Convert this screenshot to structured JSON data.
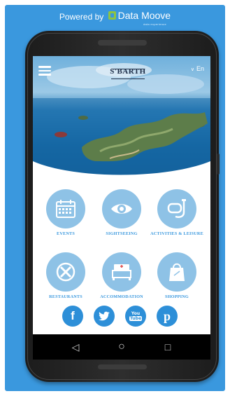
{
  "banner": {
    "powered_by": "Powered by",
    "brand_name": "Data Moove",
    "brand_tagline": "data experience"
  },
  "header": {
    "logo_text": "S'BARTH",
    "language_label": "En",
    "language_chevron": "∨"
  },
  "tiles": [
    {
      "label": "EVENTS",
      "icon": "calendar-icon"
    },
    {
      "label": "SIGHTSEEING",
      "icon": "eye-icon"
    },
    {
      "label": "ACTIVITIES & LEISURE",
      "icon": "snorkel-icon"
    },
    {
      "label": "RESTAURANTS",
      "icon": "fork-knife-icon"
    },
    {
      "label": "ACCOMMODATION",
      "icon": "bed-icon"
    },
    {
      "label": "SHOPPING",
      "icon": "shopping-bag-icon"
    }
  ],
  "social": {
    "facebook": "f",
    "twitter": "twitter-icon",
    "youtube_top": "You",
    "youtube_bottom": "Tube",
    "pinterest": "p"
  },
  "navbar": {
    "back": "◁",
    "home": "○",
    "recents": "□"
  },
  "colors": {
    "background": "#3a98de",
    "tile_circle": "#8ec2e6",
    "tile_label": "#3a98de",
    "social": "#2d8fd8"
  }
}
